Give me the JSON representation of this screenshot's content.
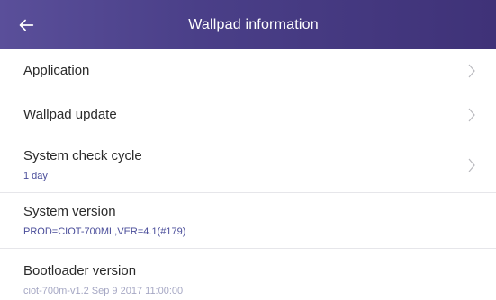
{
  "header": {
    "title": "Wallpad information",
    "back_icon": "back-arrow-icon"
  },
  "rows": [
    {
      "label": "Application",
      "value": "",
      "icon": "chevron-right-icon"
    },
    {
      "label": "Wallpad update",
      "value": "",
      "icon": "chevron-right-icon"
    },
    {
      "label": "System check cycle",
      "value": "1 day",
      "icon": "chevron-right-icon"
    },
    {
      "label": "System version",
      "value": "PROD=CIOT-700ML,VER=4.1(#179)"
    },
    {
      "label": "Bootloader version",
      "value": "ciot-700m-v1.2 Sep 9 2017 11:00:00"
    }
  ],
  "colors": {
    "header_start": "#5a4f9a",
    "header_end": "#3f3278",
    "accent_value": "#4a4d9a",
    "divider": "#e6e6ea",
    "label_text": "#2b2b2b"
  }
}
